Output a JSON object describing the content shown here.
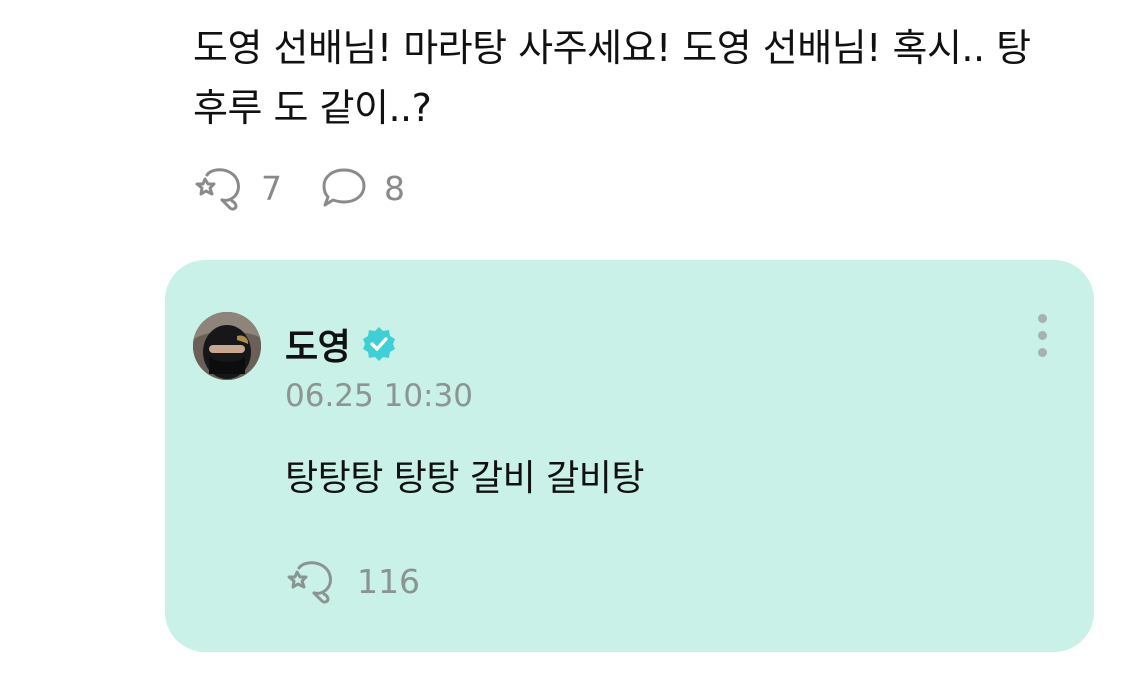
{
  "post": {
    "text": "도영 선배님! 마라탕 사주세요! 도영 선배님! 혹시.. 탕후루 도 같이..?",
    "reactions": {
      "icon": "reaction-icon",
      "count": "7"
    },
    "comments": {
      "icon": "comment-icon",
      "count": "8"
    }
  },
  "reply": {
    "author": "도영",
    "verified_icon": "verified-badge-icon",
    "timestamp": "06.25 10:30",
    "text": "탕탕탕 탕탕 갈비 갈비탕",
    "reactions": {
      "icon": "reaction-icon",
      "count": "116"
    },
    "more_icon": "more-vertical-icon"
  },
  "colors": {
    "card_background": "#c9f1e8",
    "verified": "#3fd0d6",
    "muted_text": "#8a8a8a"
  }
}
